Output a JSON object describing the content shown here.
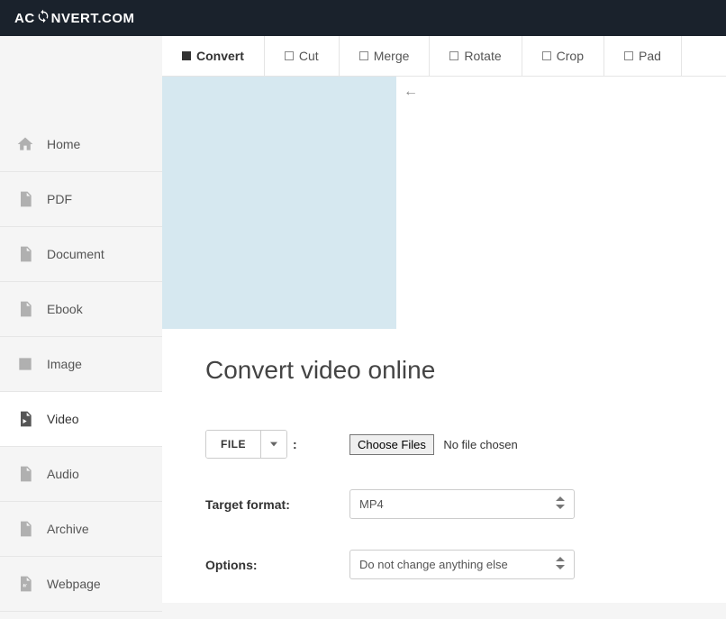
{
  "brand": {
    "left": "AC",
    "right": "NVERT.COM"
  },
  "sidebar": {
    "items": [
      {
        "label": "Home"
      },
      {
        "label": "PDF"
      },
      {
        "label": "Document"
      },
      {
        "label": "Ebook"
      },
      {
        "label": "Image"
      },
      {
        "label": "Video"
      },
      {
        "label": "Audio"
      },
      {
        "label": "Archive"
      },
      {
        "label": "Webpage"
      }
    ]
  },
  "tabs": [
    {
      "label": "Convert"
    },
    {
      "label": "Cut"
    },
    {
      "label": "Merge"
    },
    {
      "label": "Rotate"
    },
    {
      "label": "Crop"
    },
    {
      "label": "Pad"
    }
  ],
  "page": {
    "title": "Convert video online",
    "file_button": "FILE",
    "choose_label": "Choose Files",
    "nofile_label": "No file chosen",
    "target_format_label": "Target format:",
    "target_format_value": "MP4",
    "options_label": "Options:",
    "options_value": "Do not change anything else"
  },
  "adarrow": "←"
}
